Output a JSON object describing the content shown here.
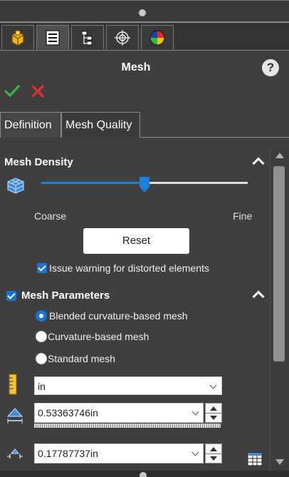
{
  "panel": {
    "title": "Mesh",
    "help_glyph": "?"
  },
  "toolbar_tabs": [
    {
      "icon": "feature-manager-icon"
    },
    {
      "icon": "property-manager-icon"
    },
    {
      "icon": "configuration-manager-icon"
    },
    {
      "icon": "dimxpert-icon"
    },
    {
      "icon": "display-manager-icon"
    }
  ],
  "property_tabs": {
    "definition": "Definition",
    "mesh_quality": "Mesh Quality"
  },
  "mesh_density": {
    "header": "Mesh Density",
    "slider_fraction": 0.5,
    "coarse_label": "Coarse",
    "fine_label": "Fine",
    "reset_label": "Reset",
    "warning_label": "Issue warning for distorted elements",
    "warning_checked": true
  },
  "mesh_parameters": {
    "header": "Mesh Parameters",
    "checked": true,
    "options": [
      {
        "label": "Blended curvature-based mesh",
        "selected": true
      },
      {
        "label": "Curvature-based mesh",
        "selected": false
      },
      {
        "label": "Standard mesh",
        "selected": false
      }
    ],
    "unit": "in",
    "max_element_size": "0.53363746in",
    "min_element_size": "0.17787737in"
  },
  "colors": {
    "background": "#3f3f3f",
    "accent": "#1a73d9",
    "ok_green": "#37b24d",
    "cancel_red": "#e03131"
  }
}
